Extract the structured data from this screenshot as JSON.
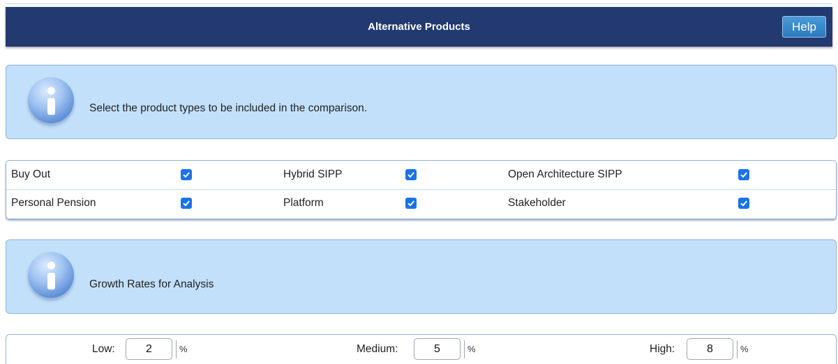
{
  "header": {
    "title": "Alternative Products",
    "help_label": "Help"
  },
  "info1": {
    "icon": "info-icon",
    "text": "Select the product types to be included in the comparison."
  },
  "products": [
    {
      "label": "Buy Out",
      "checked": true
    },
    {
      "label": "Hybrid SIPP",
      "checked": true
    },
    {
      "label": "Open Architecture SIPP",
      "checked": true
    },
    {
      "label": "Personal Pension",
      "checked": true
    },
    {
      "label": "Platform",
      "checked": true
    },
    {
      "label": "Stakeholder",
      "checked": true
    }
  ],
  "info2": {
    "icon": "info-icon",
    "text": "Growth Rates for Analysis"
  },
  "growth": {
    "low_label": "Low:",
    "low_value": "2",
    "medium_label": "Medium:",
    "medium_value": "5",
    "high_label": "High:",
    "high_value": "8",
    "unit": "%"
  },
  "colors": {
    "header_bg": "#223a70",
    "info_bg": "#c2e0fa",
    "checkbox": "#1a73e8",
    "help_button": "#2f81c4"
  }
}
